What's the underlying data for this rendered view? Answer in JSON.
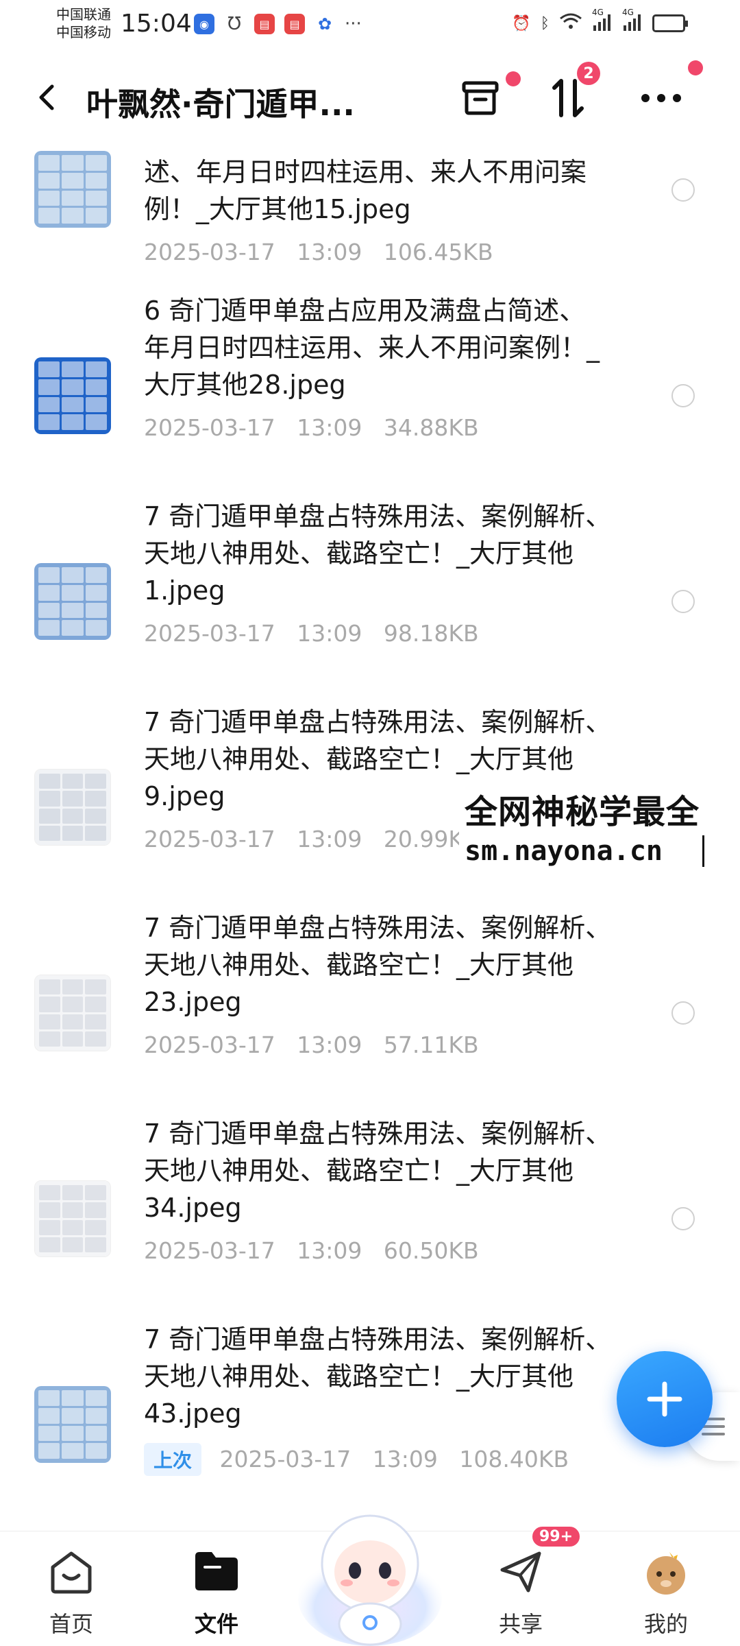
{
  "status_bar": {
    "carrier_1": "中国联通",
    "carrier_2": "中国移动",
    "time": "15:04",
    "network_1": "4G",
    "network_2": "4G",
    "more": "···"
  },
  "header": {
    "title": "叶飘然·奇门遁甲...",
    "sort_badge": "2"
  },
  "files": [
    {
      "name": "述、年月日时四柱运用、来人不用问案例！_大厅其他15.jpeg",
      "date": "2025-03-17",
      "time": "13:09",
      "size": "106.45KB",
      "thumb_color": "#8fb3dc"
    },
    {
      "name": "6 奇门遁甲单盘占应用及满盘占简述、年月日时四柱运用、来人不用问案例！_大厅其他28.jpeg",
      "date": "2025-03-17",
      "time": "13:09",
      "size": "34.88KB",
      "thumb_color": "#1f63c8"
    },
    {
      "name": "7 奇门遁甲单盘占特殊用法、案例解析、天地八神用处、截路空亡！_大厅其他1.jpeg",
      "date": "2025-03-17",
      "time": "13:09",
      "size": "98.18KB",
      "thumb_color": "#7ea6d8"
    },
    {
      "name": "7 奇门遁甲单盘占特殊用法、案例解析、天地八神用处、截路空亡！_大厅其他9.jpeg",
      "date": "2025-03-17",
      "time": "13:09",
      "size": "20.99KB",
      "thumb_color": "#f1f3f6"
    },
    {
      "name": "7 奇门遁甲单盘占特殊用法、案例解析、天地八神用处、截路空亡！_大厅其他23.jpeg",
      "date": "2025-03-17",
      "time": "13:09",
      "size": "57.11KB",
      "thumb_color": "#f4f5f7"
    },
    {
      "name": "7 奇门遁甲单盘占特殊用法、案例解析、天地八神用处、截路空亡！_大厅其他34.jpeg",
      "date": "2025-03-17",
      "time": "13:09",
      "size": "60.50KB",
      "thumb_color": "#f4f5f7"
    },
    {
      "name": "7 奇门遁甲单盘占特殊用法、案例解析、天地八神用处、截路空亡！_大厅其他43.jpeg",
      "date": "2025-03-17",
      "time": "13:09",
      "size": "108.40KB",
      "tag": "上次",
      "thumb_color": "#8fb3dc"
    }
  ],
  "watermark": {
    "line1": "全网神秘学最全",
    "line2": "sm.nayona.cn"
  },
  "bottom_nav": {
    "home": "首页",
    "files": "文件",
    "share": "共享",
    "share_badge": "99+",
    "me": "我的"
  },
  "colors": {
    "accent": "#1c7df0",
    "badge": "#f0476a",
    "meta_text": "#a9a9a9"
  }
}
